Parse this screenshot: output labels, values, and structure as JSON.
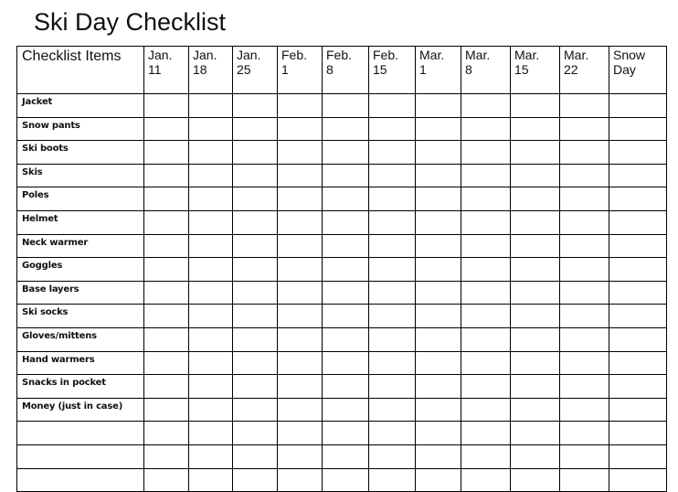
{
  "document": {
    "title": "Ski Day Checklist"
  },
  "table": {
    "items_header": "Checklist Items",
    "columns": [
      {
        "line1": "Jan.",
        "line2": "11"
      },
      {
        "line1": "Jan.",
        "line2": "18"
      },
      {
        "line1": "Jan.",
        "line2": "25"
      },
      {
        "line1": "Feb.",
        "line2": "1"
      },
      {
        "line1": "Feb.",
        "line2": "8"
      },
      {
        "line1": "Feb.",
        "line2": "15"
      },
      {
        "line1": "Mar.",
        "line2": "1"
      },
      {
        "line1": "Mar.",
        "line2": "8"
      },
      {
        "line1": "Mar.",
        "line2": "15"
      },
      {
        "line1": "Mar.",
        "line2": "22"
      },
      {
        "line1": "Snow",
        "line2": "Day"
      }
    ],
    "items": [
      "Jacket",
      "Snow pants",
      "Ski boots",
      "Skis",
      "Poles",
      "Helmet",
      "Neck warmer",
      "Goggles",
      "Base layers",
      "Ski socks",
      "Gloves/mittens",
      "Hand warmers",
      "Snacks in pocket",
      "Money (just in case)",
      "",
      "",
      ""
    ]
  }
}
